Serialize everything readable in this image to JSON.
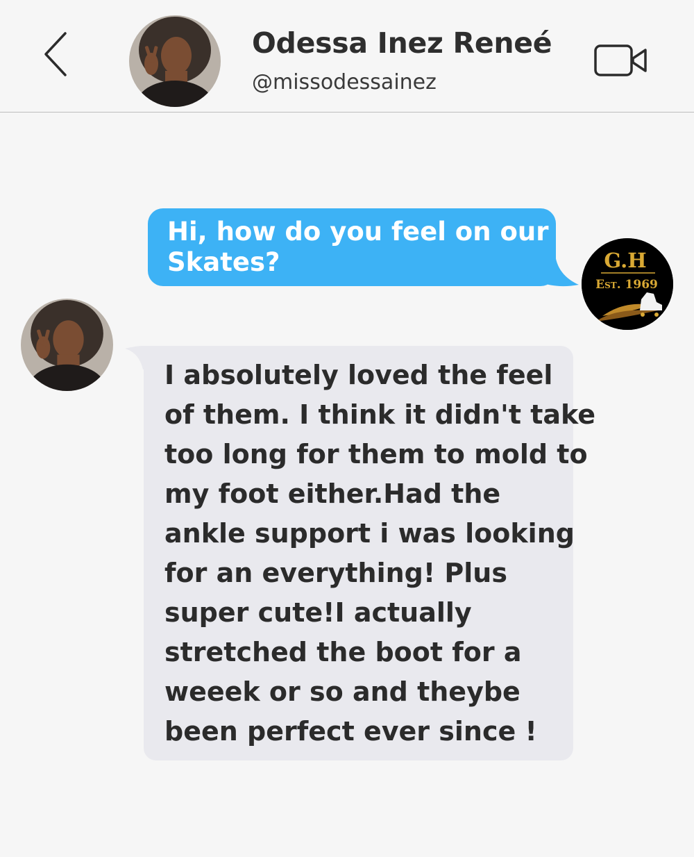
{
  "header": {
    "back_icon": "chevron-left-icon",
    "contact_name": "Odessa Inez Reneé",
    "contact_handle": "@missodessainez",
    "video_icon": "video-camera-icon"
  },
  "brand_logo": {
    "line1": "G.H",
    "line2": "Est. 1969"
  },
  "messages": [
    {
      "direction": "outgoing",
      "lines": [
        "Hi, how do you feel on our",
        "Skates?"
      ]
    },
    {
      "direction": "incoming",
      "lines": [
        "I absolutely loved the feel",
        "of them. I think it didn't take",
        "too long for them to mold to",
        "my foot either.Had the",
        "ankle support i was looking",
        "for an everything! Plus",
        "super cute!I actually",
        "stretched the boot for a",
        "weeek or so and theybe",
        "been perfect ever since !"
      ]
    }
  ],
  "colors": {
    "background": "#f6f6f6",
    "outgoing_bubble": "#3db2f5",
    "incoming_bubble": "#e9e9ee",
    "brand_gold": "#d9a934"
  }
}
